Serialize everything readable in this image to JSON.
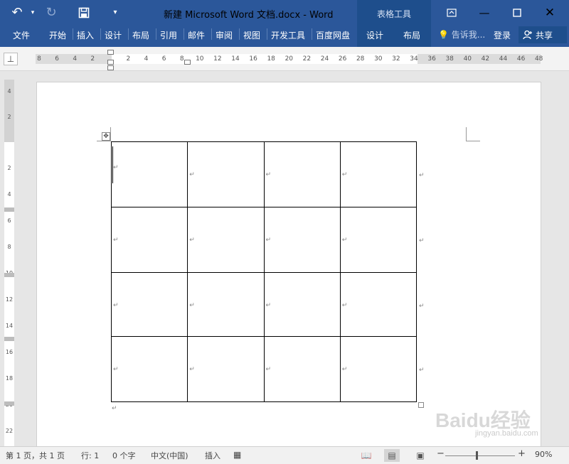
{
  "window": {
    "title": "新建 Microsoft Word 文档.docx - Word",
    "context_group": "表格工具",
    "colors": {
      "ribbon": "#2b579a",
      "ribbon_dark": "#1e4e8c"
    }
  },
  "qat": {
    "undo_icon": "undo-icon",
    "redo_icon": "redo-icon",
    "save_icon": "save-icon",
    "customize_icon": "customize-qat-icon"
  },
  "tabs": [
    "文件",
    "开始",
    "插入",
    "设计",
    "布局",
    "引用",
    "邮件",
    "审阅",
    "视图",
    "开发工具",
    "百度网盘"
  ],
  "context_tabs": [
    "设计",
    "布局"
  ],
  "tell_me": {
    "placeholder": "告诉我..."
  },
  "account": {
    "login": "登录",
    "share": "共享"
  },
  "ruler": {
    "h_labels": [
      "8",
      "6",
      "4",
      "2",
      "2",
      "4",
      "6",
      "8",
      "10",
      "12",
      "14",
      "16",
      "18",
      "20",
      "22",
      "24",
      "26",
      "28",
      "30",
      "32",
      "34",
      "36",
      "38",
      "40",
      "42",
      "44",
      "46",
      "48"
    ],
    "v_labels": [
      "4",
      "2",
      "2",
      "4",
      "6",
      "8",
      "10",
      "12",
      "14",
      "16",
      "18",
      "20",
      "22"
    ]
  },
  "table": {
    "rows": 4,
    "cols": 4,
    "cell_mark": "↵",
    "row_end_mark": "↵",
    "after_table_mark": "↵"
  },
  "watermark": {
    "text": "Baidu经验",
    "sub": "jingyan.baidu.com"
  },
  "statusbar": {
    "page": "第 1 页，共 1 页",
    "lines": "行: 1",
    "words": "0 个字",
    "language": "中文(中国)",
    "mode": "插入",
    "zoom": "90%",
    "zoom_fraction": 0.45
  }
}
